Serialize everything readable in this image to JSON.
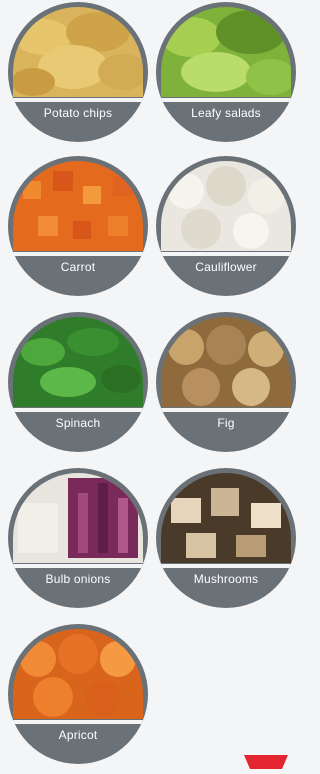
{
  "items": [
    {
      "label": "Potato chips",
      "icon": "potato-chips-photo"
    },
    {
      "label": "Leafy salads",
      "icon": "leafy-salads-photo"
    },
    {
      "label": "Carrot",
      "icon": "carrot-photo"
    },
    {
      "label": "Cauliflower",
      "icon": "cauliflower-photo"
    },
    {
      "label": "Spinach",
      "icon": "spinach-photo"
    },
    {
      "label": "Fig",
      "icon": "fig-photo"
    },
    {
      "label": "Bulb onions",
      "icon": "bulb-onions-photo"
    },
    {
      "label": "Mushrooms",
      "icon": "mushrooms-photo"
    },
    {
      "label": "Apricot",
      "icon": "apricot-photo"
    }
  ],
  "colors": {
    "background": "#f4f5f7",
    "circle": "#6a7177",
    "label_text": "#ffffff",
    "accent": "#e3262f"
  }
}
